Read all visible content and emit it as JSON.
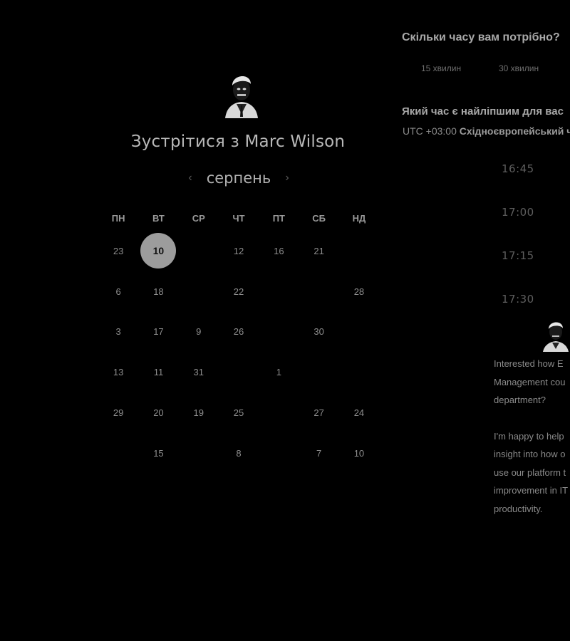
{
  "header": {
    "title_prefix": "Зустрітися з",
    "host_name": "Marc Wilson"
  },
  "calendar": {
    "month": "серпень",
    "weekdays": [
      "ПН",
      "ВТ",
      "СР",
      "ЧТ",
      "ПТ",
      "СБ",
      "НД"
    ],
    "rows": [
      [
        "23",
        "10",
        "",
        "12",
        "16",
        "21",
        ""
      ],
      [
        "6",
        "18",
        "",
        "22",
        "",
        "",
        "28"
      ],
      [
        "3",
        "17",
        "9",
        "26",
        "",
        "30",
        ""
      ],
      [
        "13",
        "11",
        "31",
        "",
        "1",
        "",
        ""
      ],
      [
        "29",
        "20",
        "19",
        "25",
        "",
        "27",
        "24"
      ],
      [
        "",
        "15",
        "",
        "8",
        "",
        "7",
        "10"
      ]
    ],
    "selected": {
      "row": 0,
      "col": 1
    }
  },
  "duration": {
    "question": "Скільки часу вам потрібно?",
    "options": [
      "15 хвилин",
      "30 хвилин"
    ]
  },
  "time": {
    "question": "Який час є найліпшим для вас",
    "timezone_offset": "UTC +03:00",
    "timezone_name": "Східноєвропейський ч",
    "slots": [
      "16:45",
      "17:00",
      "17:15",
      "17:30"
    ]
  },
  "description": {
    "lines_p1": [
      "Interested how E",
      "Management cou",
      "department?"
    ],
    "lines_p2": [
      "I'm happy to help",
      "insight into how o",
      "use our platform t",
      "improvement in IT",
      "productivity."
    ]
  },
  "colors": {
    "background": "#000000",
    "selected_day": "#9c9c9c"
  }
}
